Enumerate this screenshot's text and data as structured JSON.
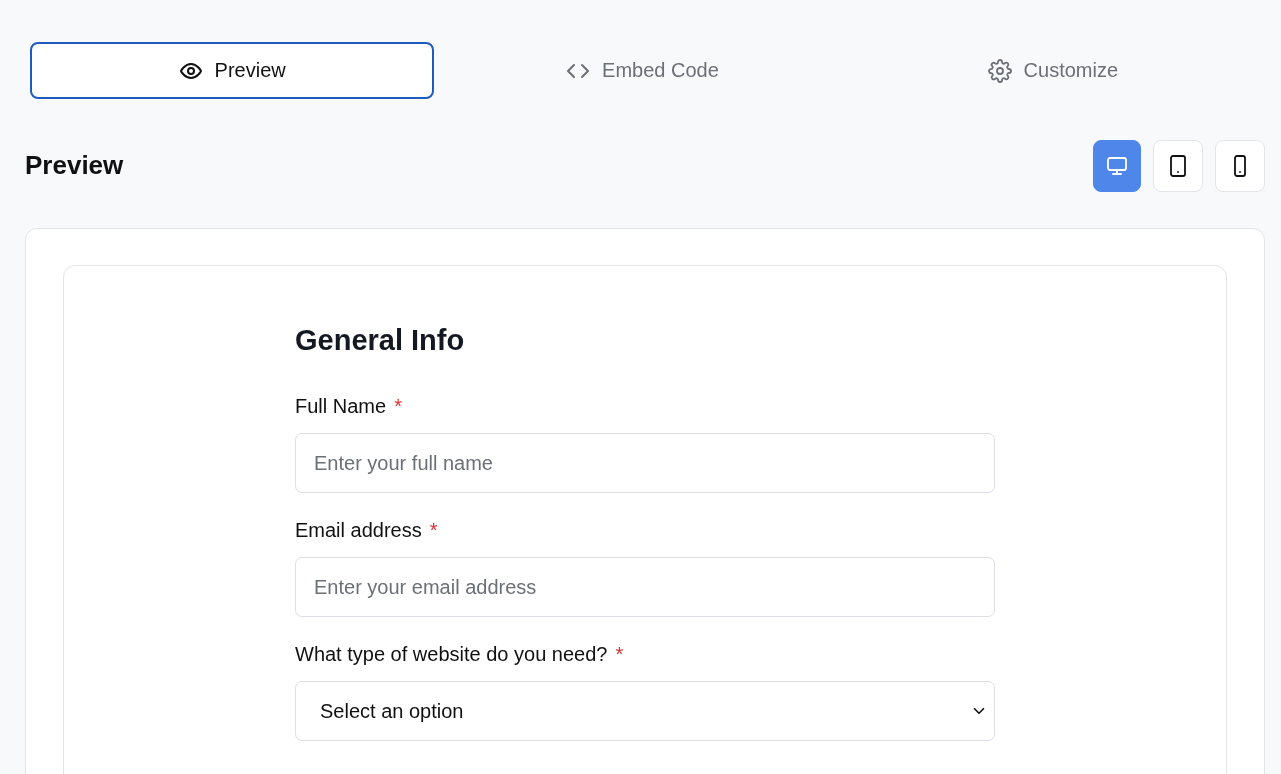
{
  "tabs": [
    {
      "label": "Preview",
      "kind": "preview",
      "selected": true
    },
    {
      "label": "Embed Code",
      "kind": "embed",
      "selected": false
    },
    {
      "label": "Customize",
      "kind": "customize",
      "selected": false
    }
  ],
  "section_title": "Preview",
  "devices": [
    {
      "kind": "desktop",
      "selected": true
    },
    {
      "kind": "tablet",
      "selected": false
    },
    {
      "kind": "phone",
      "selected": false
    }
  ],
  "form": {
    "title": "General Info",
    "fields": [
      {
        "kind": "text",
        "label": "Full Name",
        "required_mark": "*",
        "placeholder": "Enter your full name"
      },
      {
        "kind": "text",
        "label": "Email address",
        "required_mark": "*",
        "placeholder": "Enter your email address"
      },
      {
        "kind": "select",
        "label": "What type of website do you need?",
        "required_mark": "*",
        "value": "Select an option"
      }
    ]
  }
}
